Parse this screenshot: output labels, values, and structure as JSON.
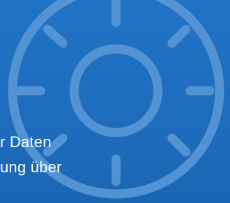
{
  "banner": {
    "caption_lines": [
      "r Daten",
      "ung über"
    ],
    "icon": "dial-gear-icon",
    "colors": {
      "background": "#1f6fc0",
      "icon_stroke": "#5d9ad8",
      "text": "#ffffff"
    }
  }
}
